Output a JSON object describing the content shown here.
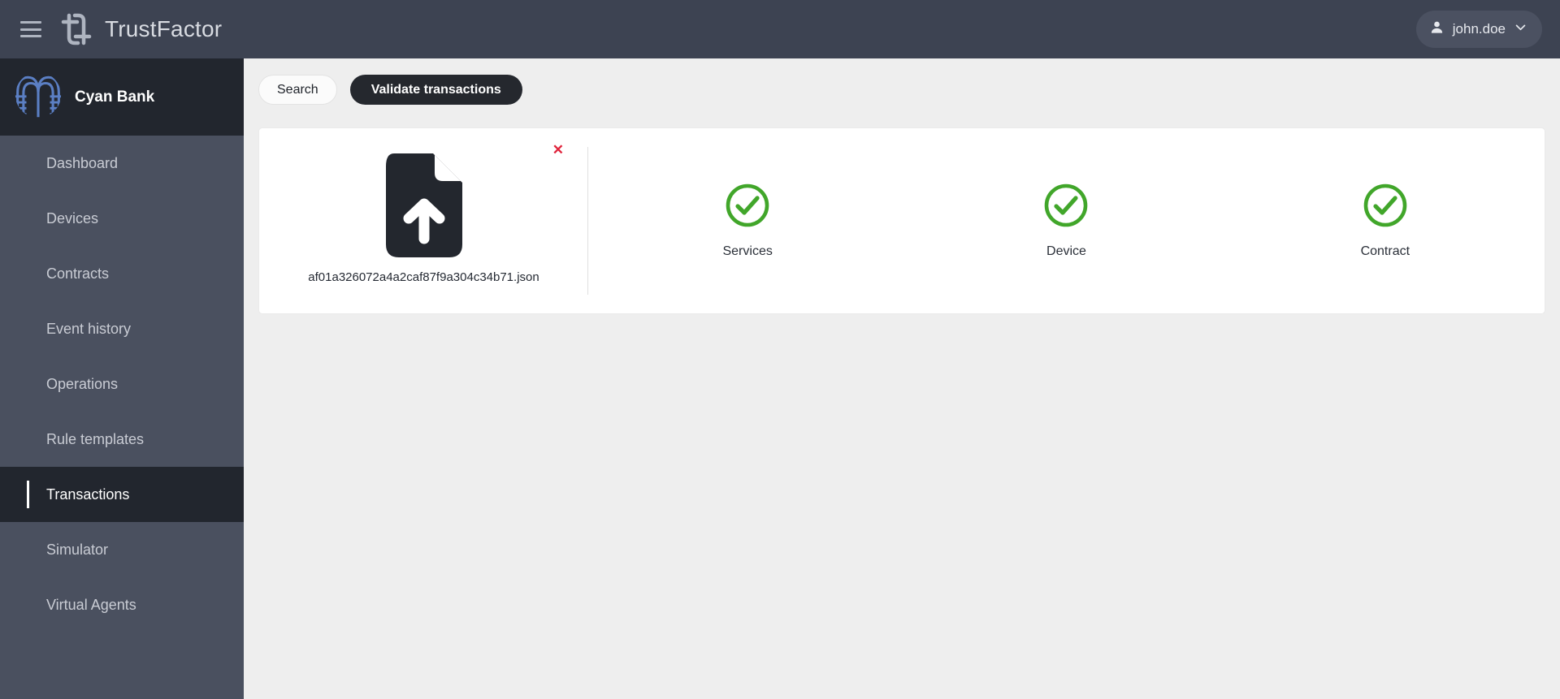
{
  "header": {
    "menu_icon": "hamburger-icon",
    "logo_icon": "trustfactor-logo-icon",
    "app_title": "TrustFactor",
    "user": {
      "avatar_icon": "person-icon",
      "name": "john.doe",
      "caret_icon": "chevron-down-icon"
    }
  },
  "sidebar": {
    "brand": {
      "logo_icon": "cyan-bank-logo-icon",
      "name": "Cyan Bank"
    },
    "items": [
      {
        "label": "Dashboard",
        "active": false
      },
      {
        "label": "Devices",
        "active": false
      },
      {
        "label": "Contracts",
        "active": false
      },
      {
        "label": "Event history",
        "active": false
      },
      {
        "label": "Operations",
        "active": false
      },
      {
        "label": "Rule templates",
        "active": false
      },
      {
        "label": "Transactions",
        "active": true
      },
      {
        "label": "Simulator",
        "active": false
      },
      {
        "label": "Virtual Agents",
        "active": false
      }
    ]
  },
  "main": {
    "tabs": [
      {
        "label": "Search",
        "active": false
      },
      {
        "label": "Validate transactions",
        "active": true
      }
    ],
    "upload_card": {
      "remove_icon": "close-x-icon",
      "remove_label": "✕",
      "file_icon": "file-upload-icon",
      "filename": "af01a326072a4a2caf87f9a304c34b71.json",
      "validations": [
        {
          "label": "Services",
          "state": "success",
          "icon": "check-circle-icon"
        },
        {
          "label": "Device",
          "state": "success",
          "icon": "check-circle-icon"
        },
        {
          "label": "Contract",
          "state": "success",
          "icon": "check-circle-icon"
        }
      ]
    }
  },
  "colors": {
    "topbar": "#3d4352",
    "sidebar": "#4a505f",
    "sidebar_active": "#22262e",
    "brand_blue": "#5b7fc4",
    "tab_active": "#25282e",
    "success_green": "#41a62a",
    "danger_red": "#e0243c",
    "canvas": "#eeeeee"
  }
}
